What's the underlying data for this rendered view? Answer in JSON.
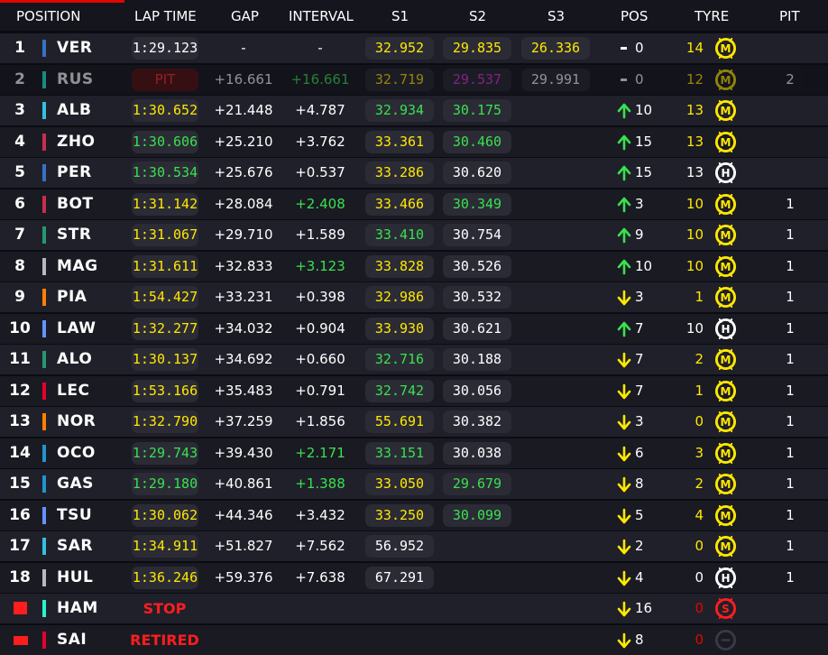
{
  "colors": {
    "accent": "#e10600",
    "pill": "#2b2b36",
    "yellow": "#ffe800",
    "green": "#39e14e",
    "purple": "#e038e0",
    "red": "#ff1e1e",
    "white": "#ffffff",
    "grey": "#9a9aa2"
  },
  "headers": {
    "position": "POSITION",
    "lap_time": "LAP TIME",
    "gap": "GAP",
    "interval": "INTERVAL",
    "s1": "S1",
    "s2": "S2",
    "s3": "S3",
    "pos": "POS",
    "tyre": "TYRE",
    "pit": "PIT"
  },
  "tyre_letters": {
    "medium": "M",
    "hard": "H",
    "soft": "S"
  },
  "rows": [
    {
      "pos": "1",
      "code": "VER",
      "team": "#3671c6",
      "lap": "1:29.123",
      "lap_c": "#ffffff",
      "gap": "-",
      "interval": "-",
      "int_c": "#ffffff",
      "s1": "32.952",
      "s1_c": "#ffe800",
      "s2": "29.835",
      "s2_c": "#ffe800",
      "s3": "26.336",
      "s3_c": "#ffe800",
      "dir": "none",
      "posnum": "0",
      "laps": "14",
      "laps_c": "#ffe800",
      "tyre": "medium",
      "tyre_state": "new",
      "pit": ""
    },
    {
      "pos": "2",
      "code": "RUS",
      "team": "#27f4d2",
      "lap": "PIT",
      "lap_c": "#e10600",
      "gap": "+16.661",
      "interval": "+16.661",
      "int_c": "#39e14e",
      "s1": "32.719",
      "s1_c": "#ffe800",
      "s2": "29.537",
      "s2_c": "#e038e0",
      "s3": "29.991",
      "s3_c": "#ffffff",
      "dir": "none",
      "posnum": "0",
      "laps": "12",
      "laps_c": "#ffe800",
      "tyre": "medium",
      "tyre_state": "new",
      "pit": "2",
      "dim": true
    },
    {
      "pos": "3",
      "code": "ALB",
      "team": "#37bedd",
      "lap": "1:30.652",
      "lap_c": "#ffe800",
      "gap": "+21.448",
      "interval": "+4.787",
      "int_c": "#ffffff",
      "s1": "32.934",
      "s1_c": "#39e14e",
      "s2": "30.175",
      "s2_c": "#39e14e",
      "s3": "",
      "s3_c": "#ffffff",
      "dir": "up",
      "posnum": "10",
      "laps": "13",
      "laps_c": "#ffe800",
      "tyre": "medium",
      "tyre_state": "used",
      "pit": ""
    },
    {
      "pos": "4",
      "code": "ZHO",
      "team": "#c92d4b",
      "lap": "1:30.606",
      "lap_c": "#39e14e",
      "gap": "+25.210",
      "interval": "+3.762",
      "int_c": "#ffffff",
      "s1": "33.361",
      "s1_c": "#ffe800",
      "s2": "30.460",
      "s2_c": "#39e14e",
      "s3": "",
      "s3_c": "#ffffff",
      "dir": "up",
      "posnum": "15",
      "laps": "13",
      "laps_c": "#ffe800",
      "tyre": "medium",
      "tyre_state": "used",
      "pit": ""
    },
    {
      "pos": "5",
      "code": "PER",
      "team": "#3671c6",
      "lap": "1:30.534",
      "lap_c": "#39e14e",
      "gap": "+25.676",
      "interval": "+0.537",
      "int_c": "#ffffff",
      "s1": "33.286",
      "s1_c": "#ffe800",
      "s2": "30.620",
      "s2_c": "#ffffff",
      "s3": "",
      "s3_c": "#ffffff",
      "dir": "up",
      "posnum": "15",
      "laps": "13",
      "laps_c": "#ffffff",
      "tyre": "hard",
      "tyre_state": "used",
      "pit": ""
    },
    {
      "pos": "6",
      "code": "BOT",
      "team": "#c92d4b",
      "lap": "1:31.142",
      "lap_c": "#ffe800",
      "gap": "+28.084",
      "interval": "+2.408",
      "int_c": "#39e14e",
      "s1": "33.466",
      "s1_c": "#ffe800",
      "s2": "30.349",
      "s2_c": "#39e14e",
      "s3": "",
      "s3_c": "#ffffff",
      "dir": "up",
      "posnum": "3",
      "laps": "10",
      "laps_c": "#ffe800",
      "tyre": "medium",
      "tyre_state": "new",
      "pit": "1"
    },
    {
      "pos": "7",
      "code": "STR",
      "team": "#229971",
      "lap": "1:31.067",
      "lap_c": "#ffe800",
      "gap": "+29.710",
      "interval": "+1.589",
      "int_c": "#ffffff",
      "s1": "33.410",
      "s1_c": "#39e14e",
      "s2": "30.754",
      "s2_c": "#ffffff",
      "s3": "",
      "s3_c": "#ffffff",
      "dir": "up",
      "posnum": "9",
      "laps": "10",
      "laps_c": "#ffe800",
      "tyre": "medium",
      "tyre_state": "new",
      "pit": "1"
    },
    {
      "pos": "8",
      "code": "MAG",
      "team": "#b6babd",
      "lap": "1:31.611",
      "lap_c": "#ffe800",
      "gap": "+32.833",
      "interval": "+3.123",
      "int_c": "#39e14e",
      "s1": "33.828",
      "s1_c": "#ffe800",
      "s2": "30.526",
      "s2_c": "#ffffff",
      "s3": "",
      "s3_c": "#ffffff",
      "dir": "up",
      "posnum": "10",
      "laps": "10",
      "laps_c": "#ffe800",
      "tyre": "medium",
      "tyre_state": "used",
      "pit": "1"
    },
    {
      "pos": "9",
      "code": "PIA",
      "team": "#ff8000",
      "lap": "1:54.427",
      "lap_c": "#ffe800",
      "gap": "+33.231",
      "interval": "+0.398",
      "int_c": "#ffffff",
      "s1": "32.986",
      "s1_c": "#ffe800",
      "s2": "30.532",
      "s2_c": "#ffffff",
      "s3": "",
      "s3_c": "#ffffff",
      "dir": "down",
      "posnum": "3",
      "laps": "1",
      "laps_c": "#ffe800",
      "tyre": "medium",
      "tyre_state": "new",
      "pit": "1"
    },
    {
      "pos": "10",
      "code": "LAW",
      "team": "#6692ff",
      "lap": "1:32.277",
      "lap_c": "#ffe800",
      "gap": "+34.032",
      "interval": "+0.904",
      "int_c": "#ffffff",
      "s1": "33.930",
      "s1_c": "#ffe800",
      "s2": "30.621",
      "s2_c": "#ffffff",
      "s3": "",
      "s3_c": "#ffffff",
      "dir": "up",
      "posnum": "7",
      "laps": "10",
      "laps_c": "#ffffff",
      "tyre": "hard",
      "tyre_state": "used",
      "pit": "1"
    },
    {
      "pos": "11",
      "code": "ALO",
      "team": "#229971",
      "lap": "1:30.137",
      "lap_c": "#ffe800",
      "gap": "+34.692",
      "interval": "+0.660",
      "int_c": "#ffffff",
      "s1": "32.716",
      "s1_c": "#39e14e",
      "s2": "30.188",
      "s2_c": "#ffffff",
      "s3": "",
      "s3_c": "#ffffff",
      "dir": "down",
      "posnum": "7",
      "laps": "2",
      "laps_c": "#ffe800",
      "tyre": "medium",
      "tyre_state": "new",
      "pit": "1"
    },
    {
      "pos": "12",
      "code": "LEC",
      "team": "#e8002d",
      "lap": "1:53.166",
      "lap_c": "#ffe800",
      "gap": "+35.483",
      "interval": "+0.791",
      "int_c": "#ffffff",
      "s1": "32.742",
      "s1_c": "#39e14e",
      "s2": "30.056",
      "s2_c": "#ffffff",
      "s3": "",
      "s3_c": "#ffffff",
      "dir": "down",
      "posnum": "7",
      "laps": "1",
      "laps_c": "#ffe800",
      "tyre": "medium",
      "tyre_state": "new",
      "pit": "1"
    },
    {
      "pos": "13",
      "code": "NOR",
      "team": "#ff8000",
      "lap": "1:32.790",
      "lap_c": "#ffe800",
      "gap": "+37.259",
      "interval": "+1.856",
      "int_c": "#ffffff",
      "s1": "55.691",
      "s1_c": "#ffe800",
      "s2": "30.382",
      "s2_c": "#ffffff",
      "s3": "",
      "s3_c": "#ffffff",
      "dir": "down",
      "posnum": "3",
      "laps": "0",
      "laps_c": "#ffe800",
      "tyre": "medium",
      "tyre_state": "new",
      "pit": "1"
    },
    {
      "pos": "14",
      "code": "OCO",
      "team": "#2293d1",
      "lap": "1:29.743",
      "lap_c": "#39e14e",
      "gap": "+39.430",
      "interval": "+2.171",
      "int_c": "#39e14e",
      "s1": "33.151",
      "s1_c": "#39e14e",
      "s2": "30.038",
      "s2_c": "#ffffff",
      "s3": "",
      "s3_c": "#ffffff",
      "dir": "down",
      "posnum": "6",
      "laps": "3",
      "laps_c": "#ffe800",
      "tyre": "medium",
      "tyre_state": "new",
      "pit": "1"
    },
    {
      "pos": "15",
      "code": "GAS",
      "team": "#2293d1",
      "lap": "1:29.180",
      "lap_c": "#39e14e",
      "gap": "+40.861",
      "interval": "+1.388",
      "int_c": "#39e14e",
      "s1": "33.050",
      "s1_c": "#ffe800",
      "s2": "29.679",
      "s2_c": "#39e14e",
      "s3": "",
      "s3_c": "#ffffff",
      "dir": "down",
      "posnum": "8",
      "laps": "2",
      "laps_c": "#ffe800",
      "tyre": "medium",
      "tyre_state": "new",
      "pit": "1"
    },
    {
      "pos": "16",
      "code": "TSU",
      "team": "#6692ff",
      "lap": "1:30.062",
      "lap_c": "#ffe800",
      "gap": "+44.346",
      "interval": "+3.432",
      "int_c": "#ffffff",
      "s1": "33.250",
      "s1_c": "#ffe800",
      "s2": "30.099",
      "s2_c": "#39e14e",
      "s3": "",
      "s3_c": "#ffffff",
      "dir": "down",
      "posnum": "5",
      "laps": "4",
      "laps_c": "#ffe800",
      "tyre": "medium",
      "tyre_state": "new",
      "pit": "1"
    },
    {
      "pos": "17",
      "code": "SAR",
      "team": "#37bedd",
      "lap": "1:34.911",
      "lap_c": "#ffe800",
      "gap": "+51.827",
      "interval": "+7.562",
      "int_c": "#ffffff",
      "s1": "56.952",
      "s1_c": "#ffffff",
      "s2": "",
      "s2_c": "#ffffff",
      "s3": "",
      "s3_c": "#ffffff",
      "dir": "down",
      "posnum": "2",
      "laps": "0",
      "laps_c": "#ffe800",
      "tyre": "medium",
      "tyre_state": "used",
      "pit": "1"
    },
    {
      "pos": "18",
      "code": "HUL",
      "team": "#b6babd",
      "lap": "1:36.246",
      "lap_c": "#ffe800",
      "gap": "+59.376",
      "interval": "+7.638",
      "int_c": "#ffffff",
      "s1": "67.291",
      "s1_c": "#ffffff",
      "s2": "",
      "s2_c": "#ffffff",
      "s3": "",
      "s3_c": "#ffffff",
      "dir": "down",
      "posnum": "4",
      "laps": "0",
      "laps_c": "#ffffff",
      "tyre": "hard",
      "tyre_state": "used",
      "pit": "1"
    },
    {
      "pos": "",
      "pos_icon": "stop-flag",
      "code": "HAM",
      "team": "#27f4d2",
      "status": "STOP",
      "gap": "",
      "interval": "",
      "s1": "",
      "s2": "",
      "s3": "",
      "dir": "down",
      "posnum": "16",
      "laps": "0",
      "laps_c": "#e10600",
      "tyre": "soft",
      "tyre_state": "used",
      "pit": ""
    },
    {
      "pos": "",
      "pos_icon": "retired-badge",
      "code": "SAI",
      "team": "#e8002d",
      "status": "RETIRED",
      "gap": "",
      "interval": "",
      "s1": "",
      "s2": "",
      "s3": "",
      "dir": "down",
      "posnum": "8",
      "laps": "0",
      "laps_c": "#e10600",
      "tyre": "none",
      "tyre_state": "none",
      "pit": ""
    }
  ]
}
